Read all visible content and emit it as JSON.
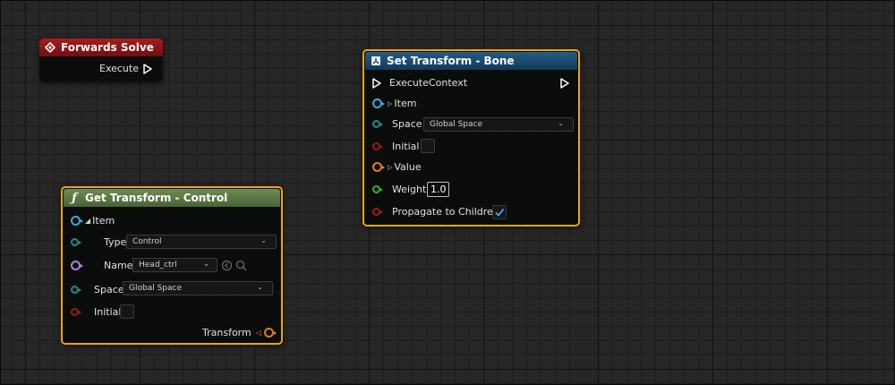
{
  "colors": {
    "selection_outline": "#f0a30a",
    "event_header": "#8e1616",
    "set_header": "#1a4d72",
    "get_header": "#5f7a44",
    "pin_item": "#3aa9d8",
    "pin_space": "#1e8f86",
    "pin_bool": "#a01818",
    "pin_transform": "#e17b1f",
    "pin_float": "#37b32a",
    "pin_name": "#b27ee0"
  },
  "forwards_solve": {
    "title": "Forwards Solve",
    "icon": "event-diamond-icon",
    "execute_label": "Execute"
  },
  "set_transform": {
    "title": "Set Transform - Bone",
    "icon": "rig-unit-icon",
    "execute_context_label": "ExecuteContext",
    "item_label": "Item",
    "space_label": "Space",
    "space_value": "Global Space",
    "initial_label": "Initial",
    "initial_checked": false,
    "value_label": "Value",
    "weight_label": "Weight",
    "weight_value": "1.0",
    "propagate_label": "Propagate to Children",
    "propagate_checked": true
  },
  "get_transform": {
    "title": "Get Transform - Control",
    "icon": "function-icon",
    "item_label": "Item",
    "type_label": "Type",
    "type_value": "Control",
    "name_label": "Name",
    "name_value": "Head_ctrl",
    "space_label": "Space",
    "space_value": "Global Space",
    "initial_label": "Initial",
    "initial_checked": false,
    "transform_label": "Transform"
  }
}
